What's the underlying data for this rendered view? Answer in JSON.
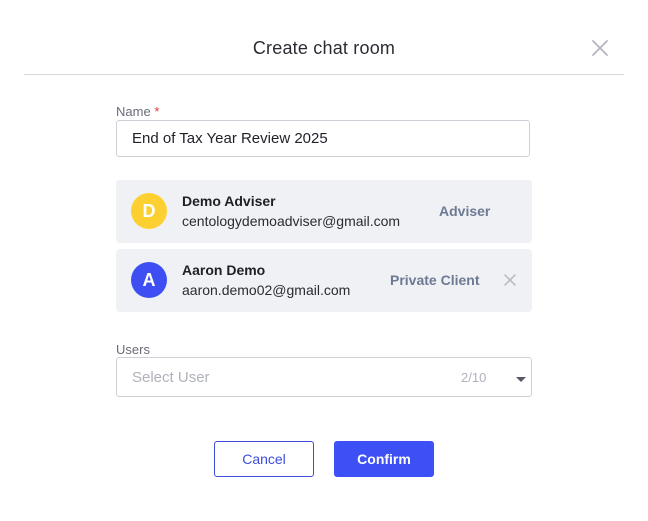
{
  "dialog": {
    "title": "Create chat room"
  },
  "name_field": {
    "label": "Name",
    "required_marker": "*",
    "value": "End of Tax Year Review 2025"
  },
  "members": [
    {
      "initial": "D",
      "name": "Demo Adviser",
      "email": "centologydemoadviser@gmail.com",
      "role": "Adviser",
      "avatar_color": "#fdd031",
      "removable": false
    },
    {
      "initial": "A",
      "name": "Aaron Demo",
      "email": "aaron.demo02@gmail.com",
      "role": "Private Client",
      "avatar_color": "#3d4ff2",
      "removable": true
    }
  ],
  "users_field": {
    "label": "Users",
    "placeholder": "Select User",
    "count": "2/10"
  },
  "buttons": {
    "cancel": "Cancel",
    "confirm": "Confirm"
  },
  "icons": {
    "close": "close-icon",
    "remove": "remove-member-icon",
    "dropdown": "chevron-down-icon"
  },
  "colors": {
    "primary": "#3d50f5",
    "role_text": "#6d7a94",
    "card_background": "#f0f1f5"
  }
}
